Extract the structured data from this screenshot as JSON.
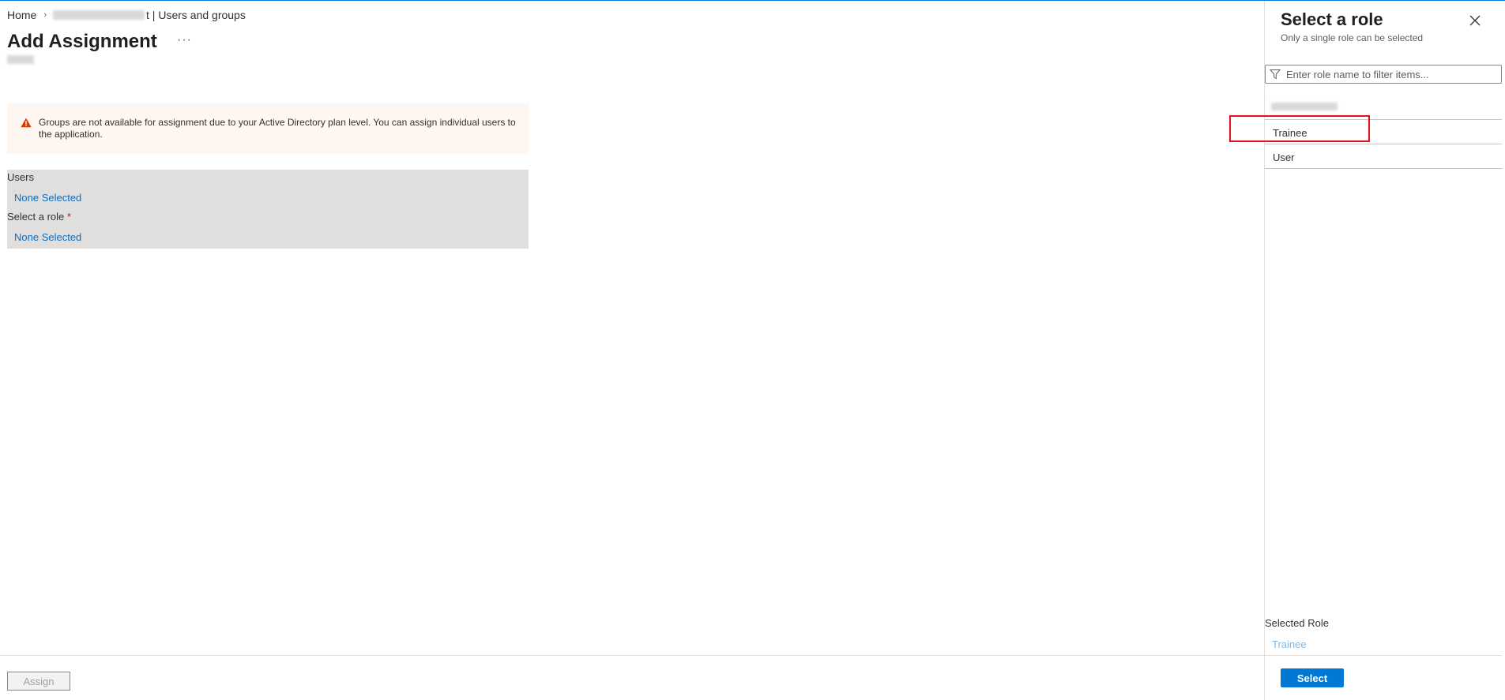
{
  "breadcrumb": {
    "home": "Home",
    "current": "t | Users and groups"
  },
  "page": {
    "title": "Add Assignment",
    "more": "···"
  },
  "warning": {
    "text": "Groups are not available for assignment due to your Active Directory plan level. You can assign individual users to the application."
  },
  "form": {
    "users_label": "Users",
    "users_value": "None Selected",
    "role_label": "Select a role",
    "role_required": "*",
    "role_value": "None Selected"
  },
  "footer": {
    "assign_label": "Assign"
  },
  "pane": {
    "title": "Select a role",
    "subtitle": "Only a single role can be selected",
    "filter_placeholder": "Enter role name to filter items...",
    "roles": [
      {
        "label": ""
      },
      {
        "label": "Trainee"
      },
      {
        "label": "User"
      }
    ],
    "selected_role_label": "Selected Role",
    "selected_role_value": "Trainee",
    "select_label": "Select"
  },
  "colors": {
    "accent": "#0078d4",
    "link": "#0f6cbd",
    "warning_bg": "#fdf6f1",
    "warning_icon": "#d83b01",
    "highlight": "#e81123"
  }
}
